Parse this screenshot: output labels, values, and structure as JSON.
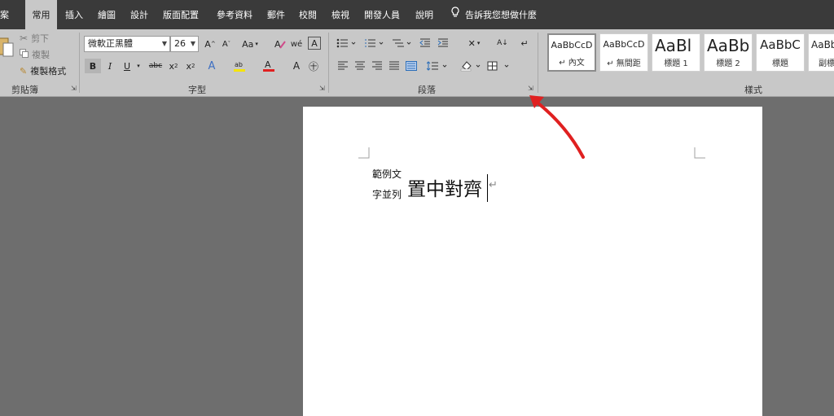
{
  "tabs": [
    {
      "id": "file",
      "label": "檔案"
    },
    {
      "id": "home",
      "label": "常用"
    },
    {
      "id": "insert",
      "label": "插入"
    },
    {
      "id": "draw",
      "label": "繪圖"
    },
    {
      "id": "design",
      "label": "設計"
    },
    {
      "id": "layout",
      "label": "版面配置"
    },
    {
      "id": "references",
      "label": "參考資料"
    },
    {
      "id": "mailings",
      "label": "郵件"
    },
    {
      "id": "review",
      "label": "校閱"
    },
    {
      "id": "view",
      "label": "檢視"
    },
    {
      "id": "developer",
      "label": "開發人員"
    },
    {
      "id": "help",
      "label": "說明"
    }
  ],
  "tell_me": "告訴我您想做什麼",
  "clipboard": {
    "paste_label": "貼上",
    "cut_label": "剪下",
    "copy_label": "複製",
    "format_painter_label": "複製格式",
    "group_label": "剪貼簿"
  },
  "font": {
    "name": "微軟正黑體",
    "size": "26",
    "group_label": "字型"
  },
  "paragraph": {
    "group_label": "段落"
  },
  "styles": {
    "group_label": "樣式",
    "items": [
      {
        "sample": "AaBbCcD",
        "name": "↵ 內文"
      },
      {
        "sample": "AaBbCcD",
        "name": "↵ 無間距"
      },
      {
        "sample": "AaBl",
        "name": "標題 1"
      },
      {
        "sample": "AaBb",
        "name": "標題 2"
      },
      {
        "sample": "AaBbC",
        "name": "標題"
      },
      {
        "sample": "AaBb",
        "name": "副標"
      }
    ]
  },
  "document": {
    "ruby_line1": "範例文",
    "ruby_line2": "字並列",
    "main_text": "置中對齊",
    "para_mark": "↵"
  },
  "colors": {
    "tab_bar": "#3a3a3a",
    "ribbon": "#c8c8c8",
    "annotation_arrow": "#e02020"
  }
}
